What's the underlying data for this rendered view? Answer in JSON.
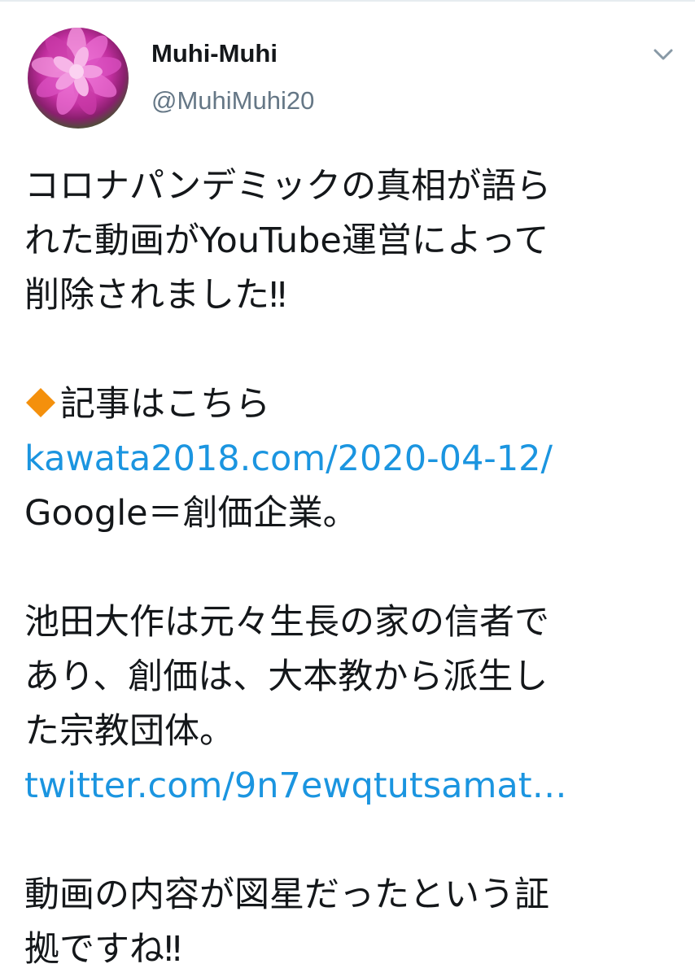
{
  "colors": {
    "text": "#14171a",
    "secondary": "#657786",
    "link": "#1b95e0",
    "diamond": "#f4900c"
  },
  "user": {
    "display_name": "Muhi-Muhi",
    "handle": "@MuhiMuhi20"
  },
  "icons": {
    "avatar": "flower-avatar",
    "menu": "chevron-down-icon",
    "bullet": "orange-diamond-icon"
  },
  "tweet": {
    "line1": "コロナパンデミックの真相が語ら",
    "line2": "れた動画がYouTube運営によって",
    "line3": "削除されました‼",
    "line4": "記事はこちら",
    "link1": "kawata2018.com/2020-04-12/",
    "line5": "Google＝創価企業。",
    "line6": "池田大作は元々生長の家の信者で",
    "line7": "あり、創価は、大本教から派生し",
    "line8": "た宗教団体。",
    "link2": "twitter.com/9n7ewqtutsamat…",
    "line9": "動画の内容が図星だったという証",
    "line10": "拠ですね‼"
  }
}
